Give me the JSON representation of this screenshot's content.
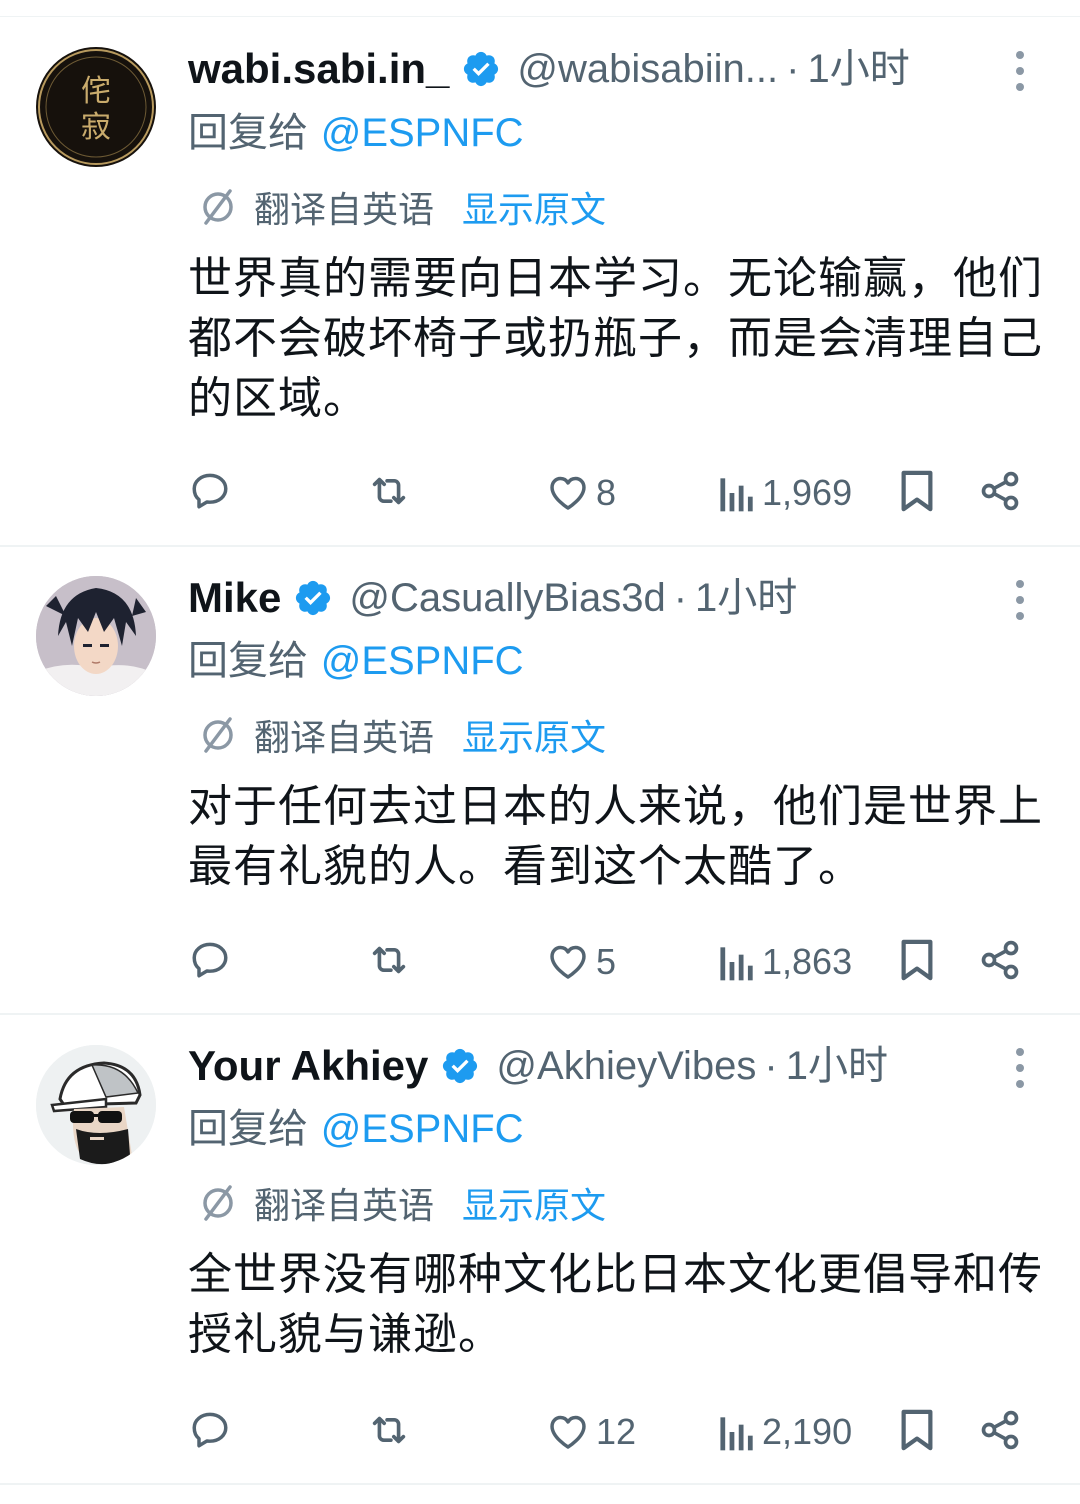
{
  "colors": {
    "accent": "#1d9bf0",
    "text": "#0f1419",
    "secondary": "#536471",
    "divider": "#eff3f4"
  },
  "tweets": [
    {
      "name": "wabi.sabi.in_",
      "handle": "@wabisabiin...",
      "separator": "·",
      "time": "1小时",
      "reply_prefix": "回复给 ",
      "reply_mention": "@ESPNFC",
      "translated_label": "翻译自英语",
      "show_original": "显示原文",
      "text": "世界真的需要向日本学习。无论输赢，他们都不会破坏椅子或扔瓶子，而是会清理自己的区域。",
      "likes": "8",
      "views": "1,969",
      "avatar_text": [
        "侘",
        "寂"
      ]
    },
    {
      "name": "Mike",
      "handle": "@CasuallyBias3d",
      "separator": "·",
      "time": "1小时",
      "reply_prefix": "回复给 ",
      "reply_mention": "@ESPNFC",
      "translated_label": "翻译自英语",
      "show_original": "显示原文",
      "text": "对于任何去过日本的人来说，他们是世界上最有礼貌的人。看到这个太酷了。",
      "likes": "5",
      "views": "1,863"
    },
    {
      "name": "Your Akhiey",
      "handle": "@AkhieyVibes",
      "separator": "·",
      "time": "1小时",
      "reply_prefix": "回复给 ",
      "reply_mention": "@ESPNFC",
      "translated_label": "翻译自英语",
      "show_original": "显示原文",
      "text": "全世界没有哪种文化比日本文化更倡导和传授礼貌与谦逊。",
      "likes": "12",
      "views": "2,190"
    }
  ]
}
